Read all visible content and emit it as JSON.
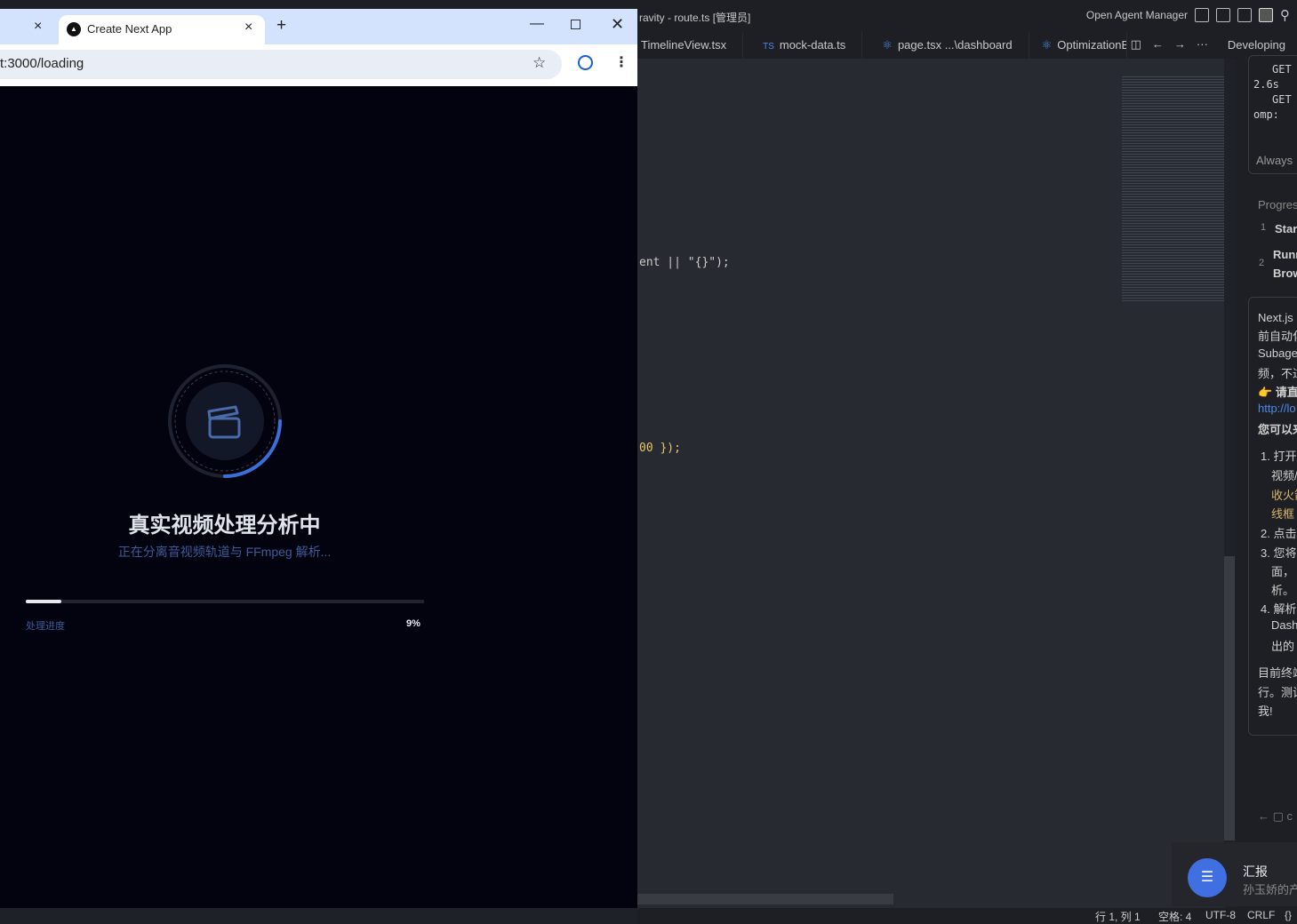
{
  "ide": {
    "title": "ravity - route.ts [管理员]",
    "agent_manager": "Open Agent Manager",
    "tabs": [
      {
        "icon": "",
        "label": "TimelineView.tsx"
      },
      {
        "icon": "TS",
        "label": "mock-data.ts"
      },
      {
        "icon": "⚛",
        "label": "page.tsx ...\\dashboard"
      },
      {
        "icon": "⚛",
        "label": "OptimizationB"
      }
    ],
    "panel_title": "Developing",
    "code_lines": [
      "ent || \"{}\");",
      "00 });"
    ],
    "panel": {
      "log": [
        "GET",
        "2.6s",
        "GET",
        "omp:"
      ],
      "always": "Always",
      "progress": "Progress",
      "steps": [
        {
          "n": "1",
          "label": "Star"
        },
        {
          "n": "2",
          "label": "Runn",
          "label2": "Brow"
        }
      ],
      "message": [
        "Next.js 开",
        "前自动化",
        "Subage",
        "频，不过",
        "👉 请直",
        "http://lo",
        "您可以来",
        "1. 打开",
        "视频/",
        "收火箭",
        "线框",
        "2. 点击",
        "3. 您将",
        "面，",
        "析。",
        "4. 解析",
        "Dash",
        "出的",
        "目前终端",
        "行。测试",
        "我!"
      ],
      "footer": "c"
    },
    "status": {
      "position": "行 1, 列 1",
      "spaces": "空格: 4",
      "encoding": "UTF-8",
      "eol": "CRLF",
      "lang": "{}"
    }
  },
  "notification": {
    "title": "汇报",
    "body": "孙玉娇的产"
  },
  "browser": {
    "prev_tab_close": "×",
    "tab_title": "Create Next App",
    "url": "t:3000/loading",
    "new_tab": "+"
  },
  "page": {
    "title": "真实视频处理分析中",
    "subtitle": "正在分离音视频轨道与 FFmpeg 解析...",
    "progress_label": "处理进度",
    "progress_text": "9%",
    "progress": 9,
    "ring_progress": 25,
    "accent": "#3b6fd8"
  }
}
